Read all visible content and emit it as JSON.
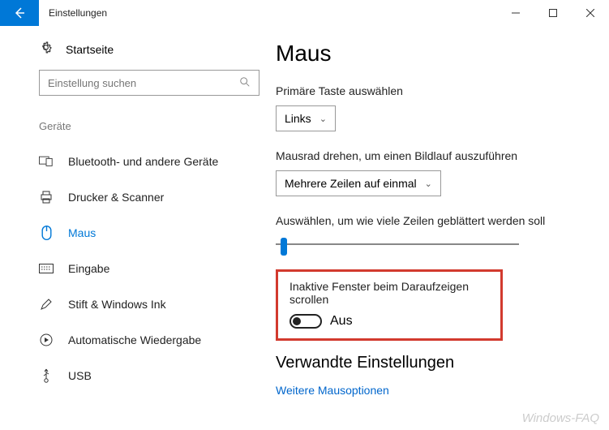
{
  "window": {
    "title": "Einstellungen"
  },
  "sidebar": {
    "home": "Startseite",
    "search_placeholder": "Einstellung suchen",
    "category": "Geräte",
    "items": [
      {
        "label": "Bluetooth- und andere Geräte"
      },
      {
        "label": "Drucker & Scanner"
      },
      {
        "label": "Maus"
      },
      {
        "label": "Eingabe"
      },
      {
        "label": "Stift & Windows Ink"
      },
      {
        "label": "Automatische Wiedergabe"
      },
      {
        "label": "USB"
      }
    ]
  },
  "main": {
    "heading": "Maus",
    "primary_label": "Primäre Taste auswählen",
    "primary_value": "Links",
    "wheel_label": "Mausrad drehen, um einen Bildlauf auszuführen",
    "wheel_value": "Mehrere Zeilen auf einmal",
    "lines_label": "Auswählen, um wie viele Zeilen geblättert werden soll",
    "inactive_label": "Inaktive Fenster beim Daraufzeigen scrollen",
    "inactive_state": "Aus",
    "related_heading": "Verwandte Einstellungen",
    "related_link": "Weitere Mausoptionen"
  },
  "watermark": "Windows-FAQ"
}
